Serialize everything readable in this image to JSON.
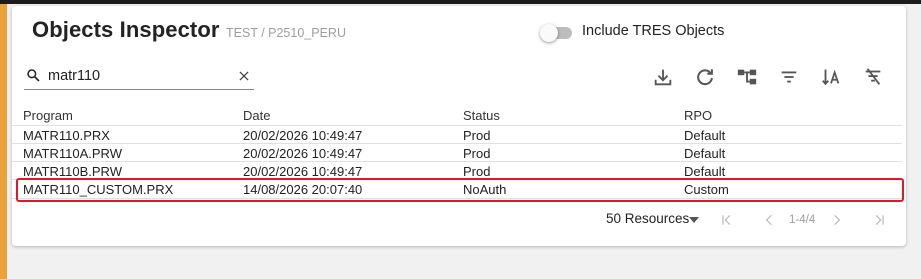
{
  "header": {
    "title": "Objects Inspector",
    "breadcrumb": "TEST / P2510_PERU",
    "toggle_label": "Include TRES Objects",
    "toggle_on": false
  },
  "search": {
    "value": "matr110",
    "placeholder": ""
  },
  "toolbar": {
    "icons": [
      "download-icon",
      "refresh-icon",
      "hierarchy-icon",
      "filter-icon",
      "sort-alpha-icon",
      "clear-filter-icon"
    ]
  },
  "table": {
    "columns": [
      "Program",
      "Date",
      "Status",
      "RPO"
    ],
    "rows": [
      [
        "MATR110.PRX",
        "20/02/2026 10:49:47",
        "Prod",
        "Default"
      ],
      [
        "MATR110A.PRW",
        "20/02/2026 10:49:47",
        "Prod",
        "Default"
      ],
      [
        "MATR110B.PRW",
        "20/02/2026 10:49:47",
        "Prod",
        "Default"
      ],
      [
        "MATR110_CUSTOM.PRX",
        "14/08/2026 20:07:40",
        "NoAuth",
        "Custom"
      ]
    ],
    "highlighted_row": 3
  },
  "pagination": {
    "page_size_label": "50 Resources",
    "range_label": "1-4/4"
  },
  "colors": {
    "accent": "#e8a33b",
    "highlight": "#e1182a"
  }
}
